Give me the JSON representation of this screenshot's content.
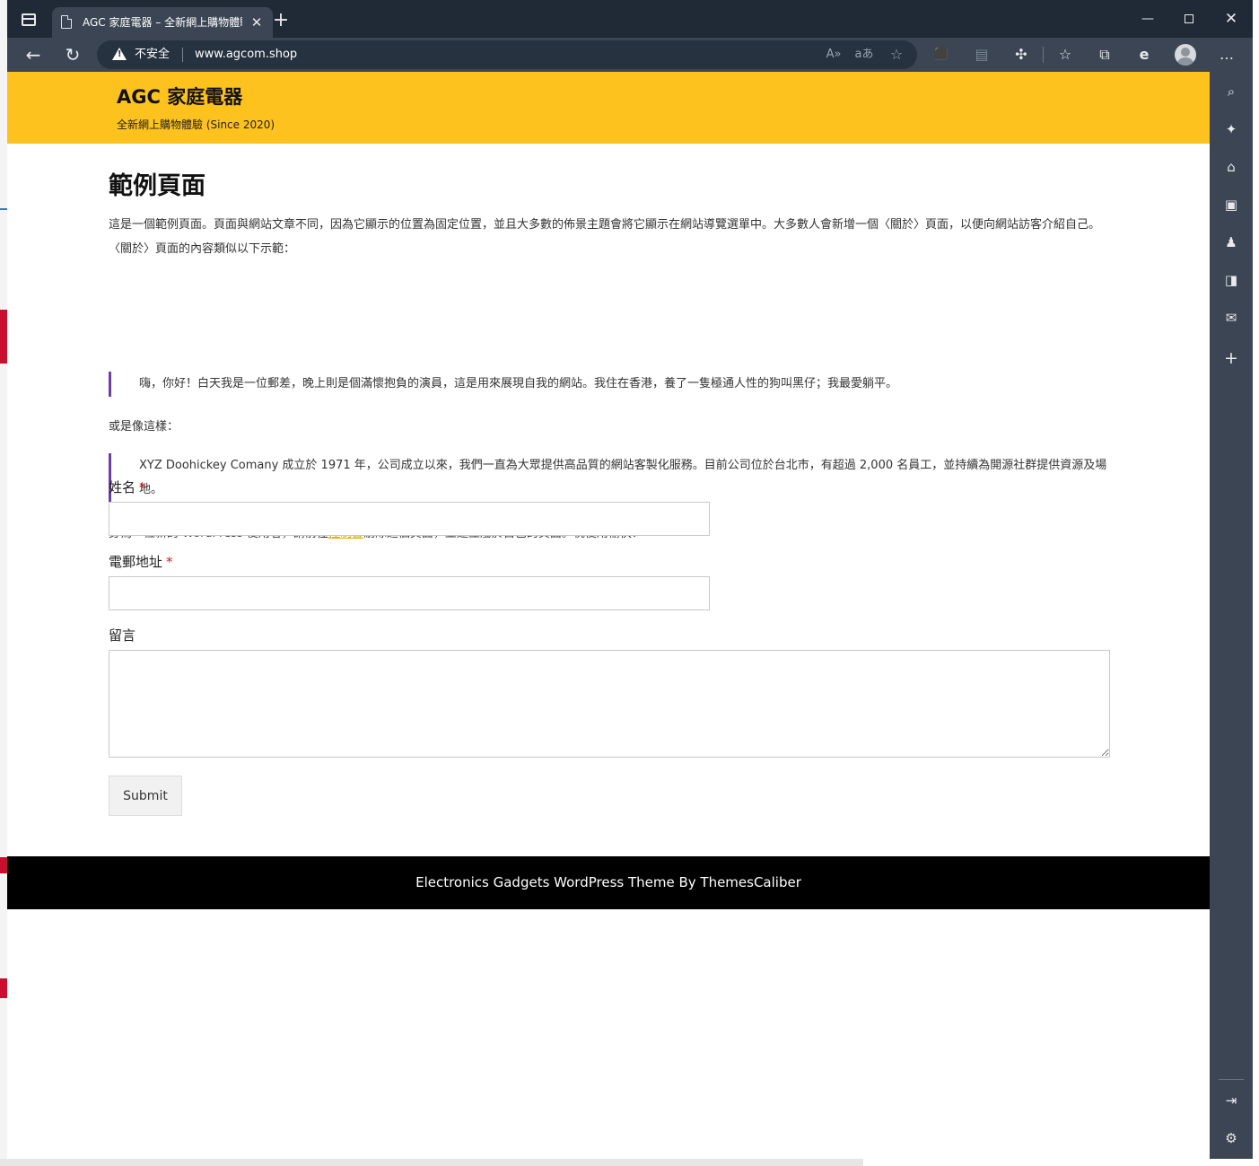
{
  "browser": {
    "tab": {
      "title": "AGC 家庭電器 – 全新網上購物體驗",
      "close_glyph": "✕"
    },
    "new_tab_glyph": "+",
    "window_controls": {
      "minimize_glyph": "—",
      "close_glyph": "✕"
    },
    "toolbar": {
      "back_glyph": "←",
      "reload_glyph": "↻",
      "security_label": "不安全",
      "url": "www.agcom.shop",
      "read_aloud_glyph": "A»",
      "translate_glyph": "aあ",
      "favorite_add_glyph": "☆",
      "extension1_glyph": "⬛",
      "extension2_glyph": "▤",
      "extensions_glyph": "✣",
      "favorites_glyph": "☆",
      "collections_glyph": "⧉",
      "edge_glyph": "e",
      "menu_glyph": "…"
    },
    "sidebar": {
      "search_glyph": "⌕",
      "discover_glyph": "✦",
      "shopping_glyph": "⌂",
      "tools_glyph": "▣",
      "games_glyph": "♟",
      "office_glyph": "◨",
      "outlook_glyph": "✉",
      "add_glyph": "+",
      "hide_glyph": "⇥",
      "settings_glyph": "⚙"
    },
    "colors": {
      "frame": "#202a36",
      "toolbar": "#3b4553",
      "header_accent": "#fdc21e",
      "quote_border": "#6a3fa8",
      "link": "#e0a800"
    }
  },
  "site": {
    "title": "AGC 家庭電器",
    "tagline": "全新網上購物體驗 (Since 2020)"
  },
  "page": {
    "title": "範例頁面",
    "intro": "這是一個範例頁面。頁面與網站文章不同，因為它顯示的位置為固定位置，並且大多數的佈景主題會將它顯示在網站導覽選單中。大多數人會新增一個〈關於〉頁面，以便向網站訪客介紹自己。〈關於〉頁面的內容類似以下示範：",
    "quote1": "嗨，你好！白天我是一位郵差，晚上則是個滿懷抱負的演員，這是用來展現自我的網站。我住在香港，養了一隻極通人性的狗叫黑仔；我最愛躺平。",
    "or_like_this": "或是像這樣：",
    "quote2": "XYZ Doohickey Comany 成立於 1971 年，公司成立以來，我們一直為大眾提供高品質的網站客製化服務。目前公司位於台北市，有超過 2,000 名員工，並持續為開源社群提供資源及場地。",
    "outro_before": "身為一位新的 WordPress 使用者，請前往",
    "outro_link": "控制台",
    "outro_after": "刪除這個頁面，並建立屬於自己的頁面。祝使用愉快！"
  },
  "form": {
    "name_label": "姓名",
    "email_label": "電郵地址",
    "required_mark": "*",
    "message_label": "留言",
    "name_value": "",
    "email_value": "",
    "message_value": "",
    "submit_label": "Submit"
  },
  "footer": {
    "text": "Electronics Gadgets WordPress Theme By ThemesCaliber"
  }
}
